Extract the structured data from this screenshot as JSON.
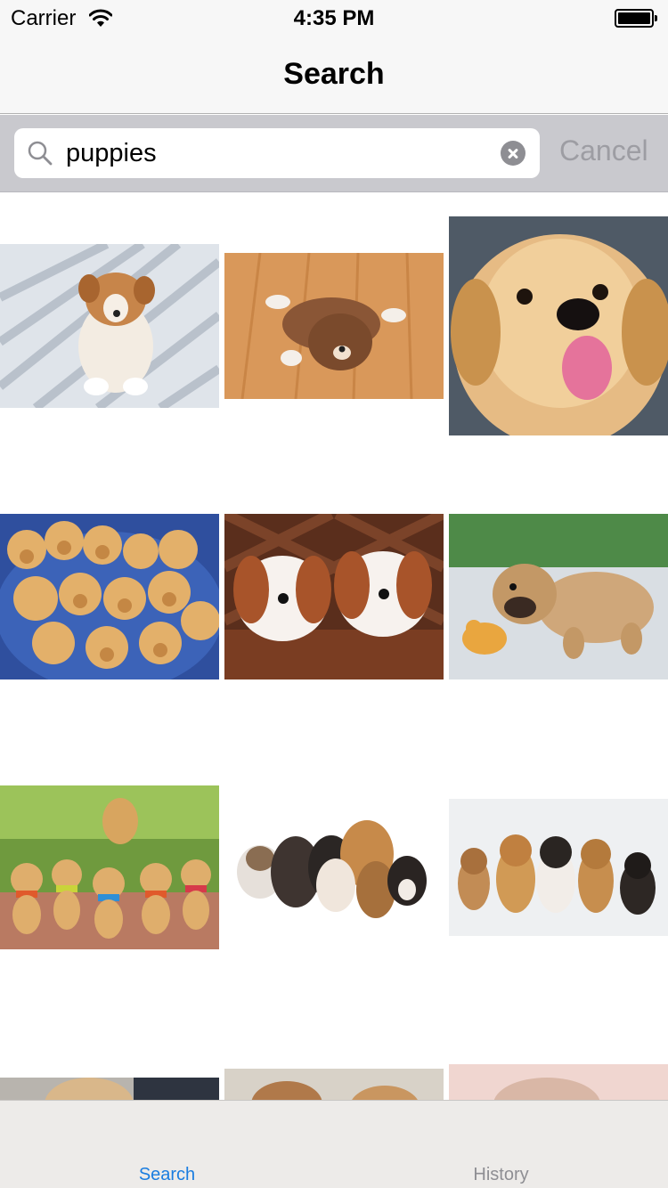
{
  "status_bar": {
    "carrier": "Carrier",
    "time": "4:35 PM",
    "icons": [
      "wifi-icon",
      "battery-icon"
    ]
  },
  "nav": {
    "title": "Search"
  },
  "search": {
    "query": "puppies",
    "cancel_label": "Cancel",
    "icons": [
      "search-icon",
      "clear-icon"
    ]
  },
  "results": {
    "items": [
      {
        "subject": "corgi-puppy-on-deck"
      },
      {
        "subject": "puppy-lying-on-wood-floor"
      },
      {
        "subject": "golden-puppy-closeup"
      },
      {
        "subject": "golden-retriever-puppies-group"
      },
      {
        "subject": "cavalier-puppies-in-basket"
      },
      {
        "subject": "bulldog-puppy-with-toy"
      },
      {
        "subject": "golden-retriever-puppies-outdoors"
      },
      {
        "subject": "mixed-puppies-pile"
      },
      {
        "subject": "puppies-lineup"
      },
      {
        "subject": "puppy-partial-1"
      },
      {
        "subject": "puppy-partial-2"
      },
      {
        "subject": "puppy-partial-3"
      }
    ]
  },
  "tab_bar": {
    "tabs": [
      {
        "label": "Search",
        "selected": true
      },
      {
        "label": "History",
        "selected": false
      }
    ]
  },
  "colors": {
    "accent": "#1a7de0",
    "inactive_tab": "#8e8e93",
    "search_bar_bg": "#c9c9ce",
    "nav_bg": "#f7f7f7",
    "cancel_text": "#9d9da3"
  }
}
